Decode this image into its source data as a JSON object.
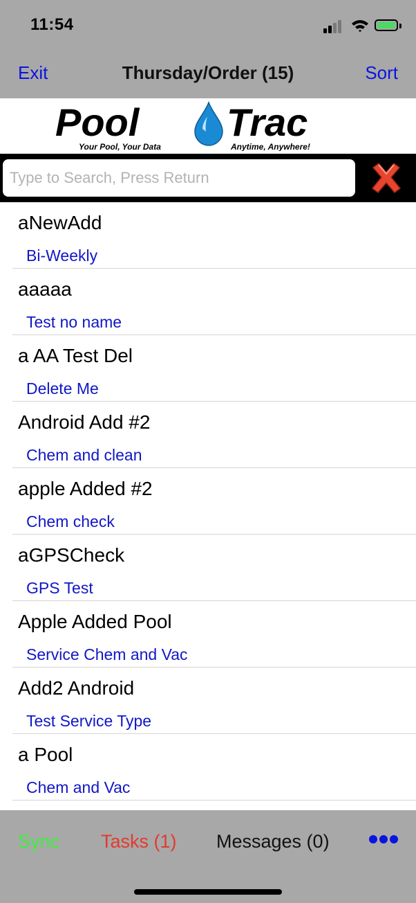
{
  "status_bar": {
    "time": "11:54"
  },
  "nav": {
    "left_button": "Exit",
    "title": "Thursday/Order (15)",
    "right_button": "Sort"
  },
  "logo": {
    "part1": "Pool",
    "part2": "Trac",
    "tagline_left": "Your Pool, Your Data",
    "tagline_right": "Anytime, Anywhere!"
  },
  "search": {
    "placeholder": "Type to Search, Press Return",
    "value": ""
  },
  "list": [
    {
      "name": "aNewAdd",
      "service": "Bi-Weekly"
    },
    {
      "name": "aaaaa",
      "service": "Test no name"
    },
    {
      "name": "a AA Test Del",
      "service": "Delete Me"
    },
    {
      "name": "Android Add #2",
      "service": "Chem and clean"
    },
    {
      "name": "apple Added #2",
      "service": "Chem check"
    },
    {
      "name": "aGPSCheck",
      "service": "GPS Test"
    },
    {
      "name": "Apple Added Pool",
      "service": "Service Chem and Vac"
    },
    {
      "name": "Add2 Android",
      "service": "Test Service Type"
    },
    {
      "name": "a Pool",
      "service": "Chem and Vac"
    }
  ],
  "toolbar": {
    "sync": "Sync",
    "tasks": "Tasks (1)",
    "messages": "Messages (0)"
  },
  "colors": {
    "link_blue": "#0a14e0",
    "service_blue": "#1117c6",
    "sync_green": "#3cf03c",
    "tasks_red": "#e33a2e",
    "bar_grey": "#a8a8a8",
    "logo_blue": "#1a8ad4"
  }
}
